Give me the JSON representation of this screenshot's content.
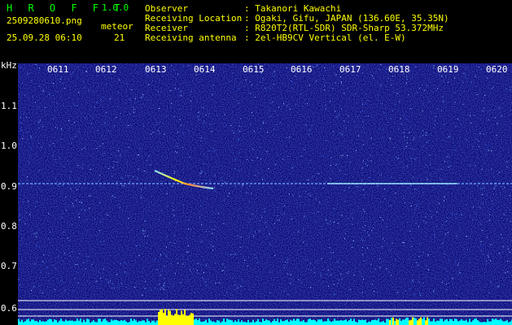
{
  "header": {
    "logo": "H R O F F T",
    "version": "1.0.0",
    "filename": "2509280610.png",
    "datetime": "25.09.28 06:10",
    "meteor_label": "meteor",
    "meteor_count": "21"
  },
  "info": {
    "observer": {
      "key": "Observer",
      "value": ": Takanori Kawachi"
    },
    "location": {
      "key": "Receiving Location",
      "value": ": Ogaki, Gifu, JAPAN (136.60E, 35.35N)"
    },
    "receiver": {
      "key": "Receiver",
      "value": ": R820T2(RTL-SDR) SDR-Sharp 53.372MHz"
    },
    "antenna": {
      "key": "Receiving antenna",
      "value": ": 2el-HB9CV Vertical (el. E-W)"
    }
  },
  "axis": {
    "y_unit": "kHz",
    "y_ticks": [
      "1.1",
      "1.0",
      "0.9",
      "0.8",
      "0.7",
      "0.6"
    ],
    "x_ticks": [
      "0611",
      "0612",
      "0613",
      "0614",
      "0615",
      "0616",
      "0617",
      "0618",
      "0619",
      "0620"
    ]
  },
  "colors": {
    "background": "#0a0a78",
    "carrier": "#88ddff",
    "meteor_head": "#ffff00",
    "baseline": "#00ffff"
  }
}
